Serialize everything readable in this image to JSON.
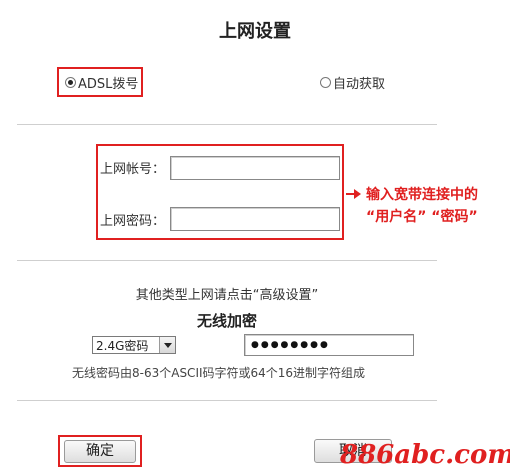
{
  "title": "上网设置",
  "wan_modes": {
    "adsl": "ADSL拨号",
    "auto": "自动获取"
  },
  "account_label": "上网帐号：",
  "password_label": "上网密码：",
  "account_value": "",
  "password_value": "",
  "annotation": {
    "line1": "输入宽带连接中的",
    "line2": "“用户名” “密码”"
  },
  "advanced_hint": "其他类型上网请点击“高级设置”",
  "wireless": {
    "heading": "无线加密",
    "security_select": "2.4G密码",
    "password_dots": "●●●●●●●●",
    "hint": "无线密码由8-63个ASCII码字符或64个16进制字符组成"
  },
  "buttons": {
    "confirm": "确定",
    "cancel": "取消"
  },
  "watermark": "886abc.com",
  "colors": {
    "highlight": "#e02020",
    "divider": "#cfcfcf"
  }
}
